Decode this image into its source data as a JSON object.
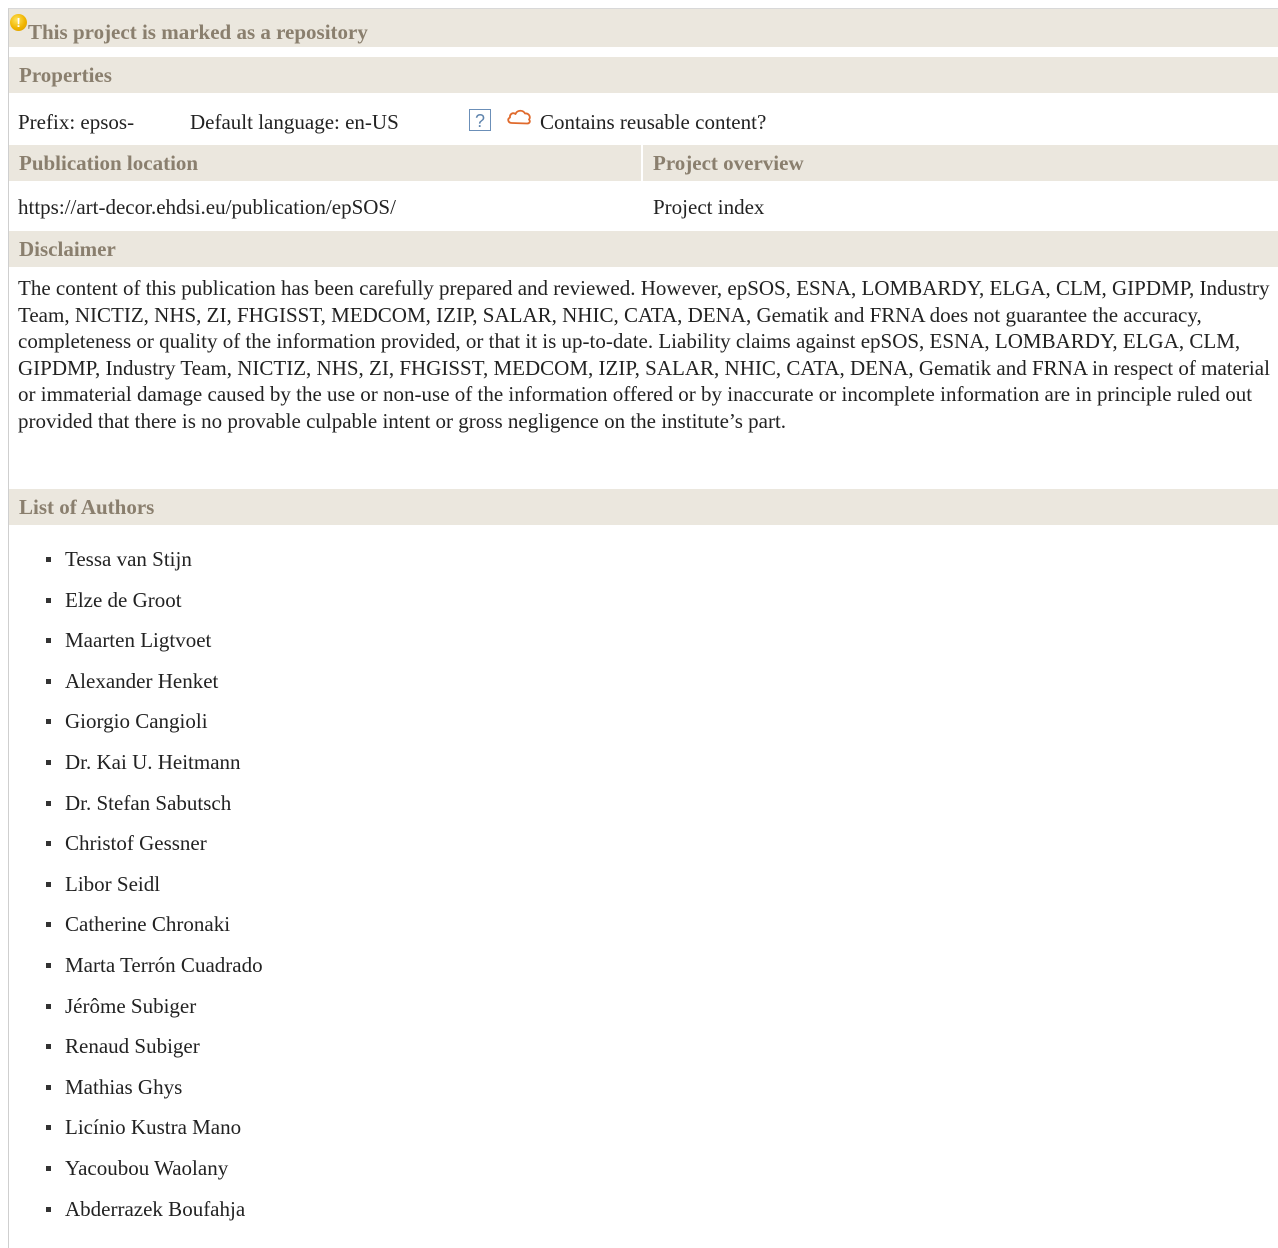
{
  "repository_notice": "This project is marked as a repository",
  "properties": {
    "header": "Properties",
    "prefix": "Prefix: epsos-",
    "default_language": "Default language: en-US",
    "help_glyph": "?",
    "reusable": "Contains reusable content?"
  },
  "publication": {
    "location_header": "Publication location",
    "overview_header": "Project overview",
    "location_value": "https://art-decor.ehdsi.eu/publication/epSOS/",
    "overview_value": "Project index"
  },
  "disclaimer": {
    "header": "Disclaimer",
    "text": "The content of this publication has been carefully prepared and reviewed. However, epSOS, ESNA, LOMBARDY, ELGA, CLM, GIPDMP, Industry Team, NICTIZ, NHS, ZI, FHGISST, MEDCOM, IZIP, SALAR, NHIC, CATA, DENA, Gematik and FRNA does not guarantee the accuracy, completeness or quality of the information provided, or that it is up-to-date. Liability claims against epSOS, ESNA, LOMBARDY, ELGA, CLM, GIPDMP, Industry Team, NICTIZ, NHS, ZI, FHGISST, MEDCOM, IZIP, SALAR, NHIC, CATA, DENA, Gematik and FRNA in respect of material or immaterial damage caused by the use or non-use of the information offered or by inaccurate or incomplete information are in principle ruled out provided that there is no provable culpable intent or gross negligence on the institute’s part."
  },
  "authors": {
    "header": "List of Authors",
    "items": [
      "Tessa van Stijn",
      "Elze de Groot",
      "Maarten Ligtvoet",
      "Alexander Henket",
      "Giorgio Cangioli",
      "Dr. Kai U. Heitmann",
      "Dr. Stefan Sabutsch",
      "Christof Gessner",
      "Libor Seidl",
      "Catherine Chronaki",
      "Marta Terrón Cuadrado",
      "Jérôme Subiger",
      "Renaud Subiger",
      "Mathias Ghys",
      "Licínio Kustra Mano",
      "Yacoubou Waolany",
      "Abderrazek Boufahja"
    ]
  },
  "colors": {
    "header_bg": "#ebe7de",
    "header_text": "#8a7f6e",
    "warning": "#f0b400",
    "cloud": "#e06a2c",
    "help": "#5f84ad"
  },
  "icons": {
    "warning": "warning-icon",
    "help": "help-icon",
    "cloud": "cloud-icon"
  }
}
